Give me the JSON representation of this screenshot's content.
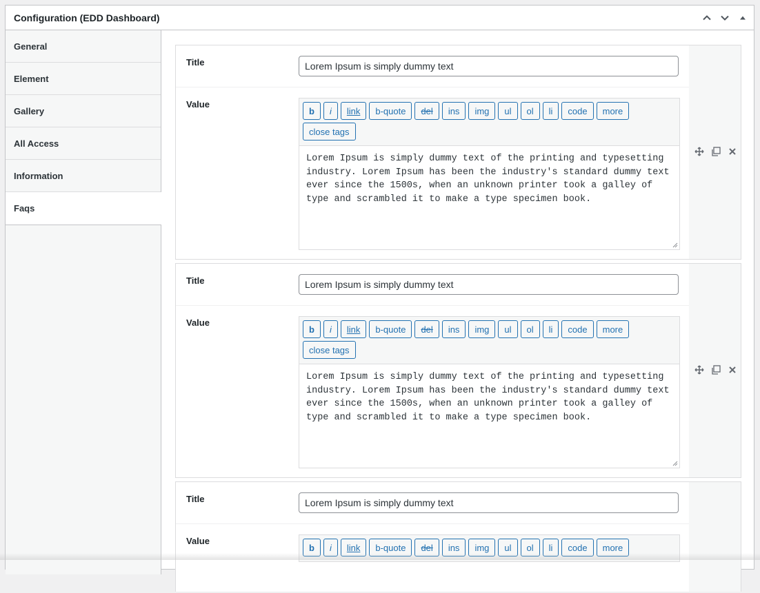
{
  "panel": {
    "title": "Configuration (EDD Dashboard)"
  },
  "sidebar": {
    "tabs": [
      {
        "label": "General"
      },
      {
        "label": "Element"
      },
      {
        "label": "Gallery"
      },
      {
        "label": "All Access"
      },
      {
        "label": "Information"
      },
      {
        "label": "Faqs",
        "active": true
      }
    ]
  },
  "field_labels": {
    "title": "Title",
    "value": "Value"
  },
  "toolbar": {
    "buttons": [
      "b",
      "i",
      "link",
      "b-quote",
      "del",
      "ins",
      "img",
      "ul",
      "ol",
      "li",
      "code",
      "more",
      "close tags"
    ]
  },
  "faqs": [
    {
      "title": "Lorem Ipsum is simply dummy text",
      "value": "Lorem Ipsum is simply dummy text of the printing and typesetting industry. Lorem Ipsum has been the industry's standard dummy text ever since the 1500s, when an unknown printer took a galley of type and scrambled it to make a type specimen book."
    },
    {
      "title": "Lorem Ipsum is simply dummy text",
      "value": "Lorem Ipsum is simply dummy text of the printing and typesetting industry. Lorem Ipsum has been the industry's standard dummy text ever since the 1500s, when an unknown printer took a galley of type and scrambled it to make a type specimen book."
    },
    {
      "title": "Lorem Ipsum is simply dummy text",
      "value": ""
    }
  ],
  "icons": {
    "collapse_up": "chevron-up-icon",
    "collapse_down": "chevron-down-icon",
    "toggle": "triangle-up-icon",
    "move": "move-icon",
    "duplicate": "duplicate-icon",
    "remove": "close-icon"
  }
}
